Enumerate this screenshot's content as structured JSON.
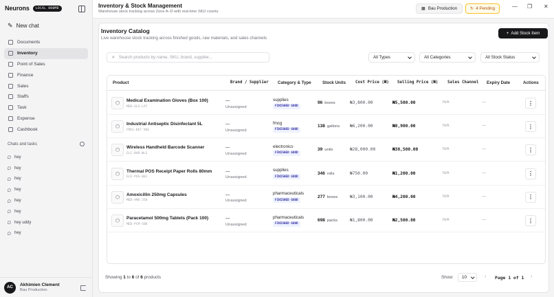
{
  "sidebar": {
    "brand": "Neurons",
    "badge": "LOCAL 800MB",
    "new_chat": "New chat",
    "items": [
      {
        "label": "Documents",
        "active": false
      },
      {
        "label": "Inventory",
        "active": true
      },
      {
        "label": "Point of Sales",
        "active": false
      },
      {
        "label": "Finance",
        "active": false
      },
      {
        "label": "Sales",
        "active": false
      },
      {
        "label": "Staffs",
        "active": false
      },
      {
        "label": "Task",
        "active": false
      },
      {
        "label": "Expense",
        "active": false
      },
      {
        "label": "Cashbook",
        "active": false
      }
    ],
    "chats_heading": "Chats and tasks",
    "chats": [
      "hey",
      "hey",
      "hey",
      "hey",
      "hey",
      "hey",
      "hey uddy",
      "hey"
    ],
    "user": {
      "initials": "AC",
      "name": "Akhimien Clement",
      "org": "Bau Production"
    }
  },
  "topbar": {
    "title": "Inventory & Stock Management",
    "subtitle": "Warehouse stock tracking across Zone A–D with real-time SKU counts",
    "org": "Bau Production",
    "pending": "4 Pending"
  },
  "catalog": {
    "title": "Inventory Catalog",
    "subtitle": "Live warehouse stock tracking across finished goods, raw materials, and sales channels",
    "add_button": "Add Stock Item",
    "search_placeholder": "Search products by name, SKU, brand, supplier...",
    "filters": {
      "types": "All Types",
      "categories": "All Categories",
      "status": "All Stock Status"
    },
    "columns": [
      "Product",
      "Brand / Supplier",
      "Category & Type",
      "Stock Units",
      "Cost Price (₦)",
      "Selling Price (₦)",
      "Sales Channel",
      "Expiry Date",
      "Actions"
    ],
    "rows": [
      {
        "name": "Medical Examination Gloves (Box 100)",
        "sku": "MED-GLV-LAT",
        "brand": "—",
        "supplier": "Unassigned",
        "category": "supplies",
        "type": "FINISHED GOOD",
        "qty": "96",
        "unit": "boxes",
        "cost": "₦3,800.00",
        "sell": "₦5,500.00",
        "channel": "N/A",
        "expiry": "—"
      },
      {
        "name": "Industrial Antiseptic Disinfectant 5L",
        "sku": "FMCG-DET-5KG",
        "brand": "—",
        "supplier": "Unassigned",
        "category": "fmcg",
        "type": "FINISHED GOOD",
        "qty": "138",
        "unit": "gallons",
        "cost": "₦6,200.00",
        "sell": "₦8,900.00",
        "channel": "N/A",
        "expiry": "—"
      },
      {
        "name": "Wireless Handheld Barcode Scanner",
        "sku": "ELC-BAR-WLS",
        "brand": "—",
        "supplier": "Unassigned",
        "category": "electronics",
        "type": "FINISHED GOOD",
        "qty": "39",
        "unit": "units",
        "cost": "₦28,000.00",
        "sell": "₦38,500.00",
        "channel": "N/A",
        "expiry": "—"
      },
      {
        "name": "Thermal POS Receipt Paper Rolls 80mm",
        "sku": "ELE-POS-001",
        "brand": "—",
        "supplier": "Unassigned",
        "category": "supplies",
        "type": "FINISHED GOOD",
        "qty": "346",
        "unit": "rolls",
        "cost": "₦750.00",
        "sell": "₦1,200.00",
        "channel": "N/A",
        "expiry": "—"
      },
      {
        "name": "Amoxicillin 250mg Capsules",
        "sku": "MED-AMX-250",
        "brand": "—",
        "supplier": "Unassigned",
        "category": "pharmaceuticals",
        "type": "FINISHED GOOD",
        "qty": "277",
        "unit": "boxes",
        "cost": "₦3,100.00",
        "sell": "₦4,200.00",
        "channel": "N/A",
        "expiry": "—"
      },
      {
        "name": "Paracetamol 500mg Tablets (Pack 100)",
        "sku": "MED-PCM-500",
        "brand": "—",
        "supplier": "Unassigned",
        "category": "pharmaceuticals",
        "type": "FINISHED GOOD",
        "qty": "698",
        "unit": "packs",
        "cost": "₦1,800.00",
        "sell": "₦2,500.00",
        "channel": "N/A",
        "expiry": "—"
      }
    ],
    "footer": {
      "showing_prefix": "Showing",
      "from": "1",
      "to_word": "to",
      "to": "6",
      "of_word": "of",
      "total": "6",
      "suffix": "products",
      "show_label": "Show:",
      "page_size": "10",
      "page_indicator": "Page 1 of 1"
    }
  }
}
